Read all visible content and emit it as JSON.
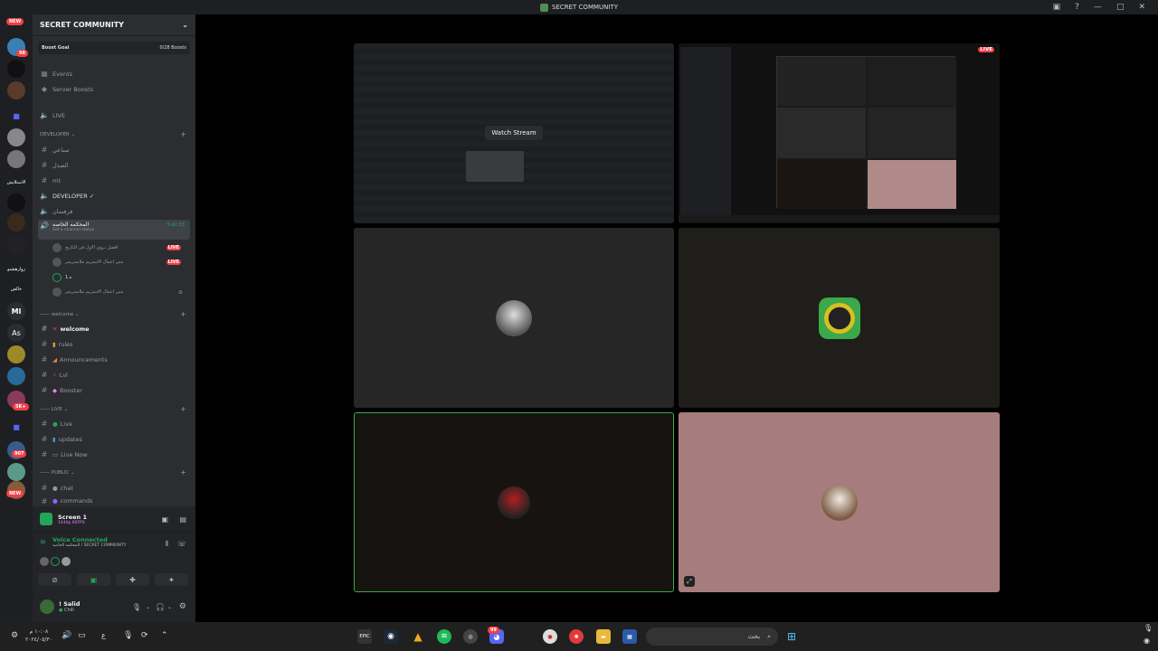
{
  "window": {
    "title": "SECRET COMMUNITY"
  },
  "server": {
    "name": "SECRET COMMUNITY",
    "boost_goal": "Boost Goal",
    "boost_count": "0/28 Boosts"
  },
  "rail": {
    "top_badge": "NEW",
    "badge_98": "98",
    "label_1": "الاستلايش",
    "label_2": "زوارهشنو",
    "label_3": "خالص",
    "ml": "Ml",
    "as": "As",
    "badge_5k": "5K+",
    "badge_907": "907",
    "bottom_badge": "NEW"
  },
  "sidebar": {
    "events": "Events",
    "server_boosts": "Server Boosts",
    "live": "LIVE",
    "cat_developer": "DEVELOPER",
    "ch_1": "سناعي",
    "ch_2": "الصدل",
    "ch_3": "mt",
    "voice_developer": "DEVELOPER ✓",
    "ch_4": "فرقسان",
    "court_channel": "المحكمه الخاصه",
    "court_status": "Set a channel status",
    "court_timer": "5:42:33",
    "voice_users": [
      {
        "name": "افضل برؤي الاول في التاريخ",
        "live": "LIVE"
      },
      {
        "name": "متير اعمال الاستريم ملاستريمر",
        "live": "LIVE"
      },
      {
        "name": "1.ه",
        "live": ""
      },
      {
        "name": "متير اعمال الاستريم ملاستريمر",
        "live": ""
      }
    ],
    "cat_welcome": "welcome",
    "ch_welcome": "welcome",
    "ch_rules": "rules",
    "ch_announcements": "Announcements",
    "ch_lvl": "Lvl",
    "ch_booster": "Booster",
    "cat_live": "LIVE",
    "ch_live": "Live",
    "ch_updates": "updates",
    "ch_livenow": "Live Now",
    "cat_public": "PUBLIC",
    "ch_chat": "chat",
    "ch_commands": "commands"
  },
  "screen": {
    "title": "Screen 1",
    "quality": "1440p 60FPS"
  },
  "voice": {
    "status": "Voice Connected",
    "location": "المحكمه الخاصه / SECRET COMMUNITY"
  },
  "user": {
    "name": "! Salid",
    "status": "Chill"
  },
  "stage": {
    "watch_stream": "Watch Stream",
    "live_badge": "LIVE"
  },
  "taskbar": {
    "search_placeholder": "بحث",
    "clock_time": "١٠:٠٨ م",
    "clock_date": "٢٠٢٤/٠٥/٣٠",
    "lang": "ع",
    "epic": "EPIC",
    "discord_badge": "99"
  },
  "colors": {
    "accent_green": "#23a55a",
    "live_red": "#f23f43",
    "tile_pink": "#a67c7c",
    "tile_dark": "#1e1e1e"
  }
}
